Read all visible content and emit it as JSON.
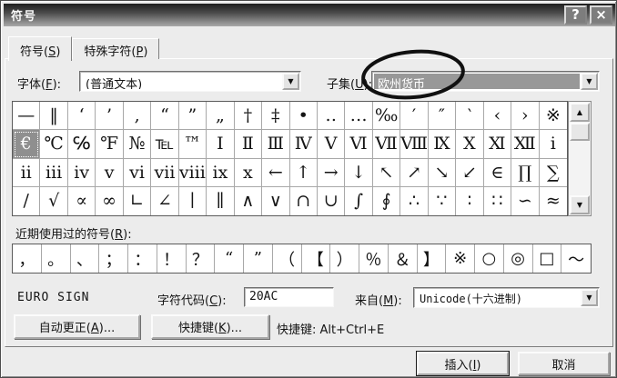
{
  "window": {
    "title": "符号",
    "help_glyph": "?",
    "close_glyph": "×"
  },
  "tabs": [
    {
      "pre": "符号(",
      "key": "S",
      "post": ")"
    },
    {
      "pre": "特殊字符(",
      "key": "P",
      "post": ")"
    }
  ],
  "controls": {
    "font": {
      "label": {
        "pre": "字体(",
        "key": "F",
        "post": "):"
      },
      "value": "(普通文本)"
    },
    "subset": {
      "label": {
        "pre": "子集(",
        "key": "U",
        "post": "):"
      },
      "value": "欧州货币"
    }
  },
  "icons": {
    "dropdown_arrow": "▼",
    "scroll_up": "▲",
    "scroll_down": "▼"
  },
  "grid": {
    "rows": [
      [
        "—",
        "‖",
        "‘",
        "’",
        "‚",
        "“",
        "”",
        "„",
        "†",
        "‡",
        "•",
        "‥",
        "…",
        "‰",
        "′",
        "″",
        "‵",
        "‹",
        "›",
        "※"
      ],
      [
        "€",
        "℃",
        "℅",
        "℉",
        "№",
        "℡",
        "™",
        "Ⅰ",
        "Ⅱ",
        "Ⅲ",
        "Ⅳ",
        "Ⅴ",
        "Ⅵ",
        "Ⅶ",
        "Ⅷ",
        "Ⅸ",
        "Ⅹ",
        "Ⅺ",
        "Ⅻ",
        "ⅰ"
      ],
      [
        "ⅱ",
        "ⅲ",
        "ⅳ",
        "ⅴ",
        "ⅵ",
        "ⅶ",
        "ⅷ",
        "ⅸ",
        "ⅹ",
        "←",
        "↑",
        "→",
        "↓",
        "↖",
        "↗",
        "↘",
        "↙",
        "∈",
        "∏",
        "∑"
      ],
      [
        "∕",
        "√",
        "∝",
        "∞",
        "∟",
        "∠",
        "∣",
        "∥",
        "∧",
        "∨",
        "∩",
        "∪",
        "∫",
        "∮",
        "∴",
        "∵",
        "∶",
        "∷",
        "∽",
        "≈"
      ]
    ],
    "selected": {
      "row": 1,
      "col": 0,
      "symbol": "€"
    }
  },
  "recent": {
    "label": {
      "pre": "近期使用过的符号(",
      "key": "R",
      "post": "):"
    },
    "symbols": [
      "，",
      "。",
      "、",
      "；",
      "：",
      "！",
      "？",
      "“",
      "”",
      "（",
      "【",
      "）",
      "％",
      "＆",
      "】",
      "※",
      "○",
      "◎",
      "□",
      "～"
    ]
  },
  "charinfo": {
    "description": "EURO SIGN",
    "code_label": {
      "pre": "字符代码(",
      "key": "C",
      "post": "):"
    },
    "code_value": "20AC",
    "from_label": {
      "pre": "来自(",
      "key": "M",
      "post": "):"
    },
    "from_value": "Unicode(十六进制)"
  },
  "actions": {
    "autocorrect": {
      "pre": "自动更正(",
      "key": "A",
      "post": ")..."
    },
    "shortcut_button": {
      "pre": "快捷键(",
      "key": "K",
      "post": ")..."
    },
    "shortcut_text": "快捷键: Alt+Ctrl+E"
  },
  "footer": {
    "insert": {
      "pre": "插入(",
      "key": "I",
      "post": ")"
    },
    "cancel": "取消"
  },
  "colors": {
    "selection_bg": "#8f8f8f",
    "annotation_stroke": "#101010",
    "titlebar_dark": "#1f1f1f",
    "titlebar_light": "#a8a8a8",
    "dialog_bg": "#ececec"
  }
}
